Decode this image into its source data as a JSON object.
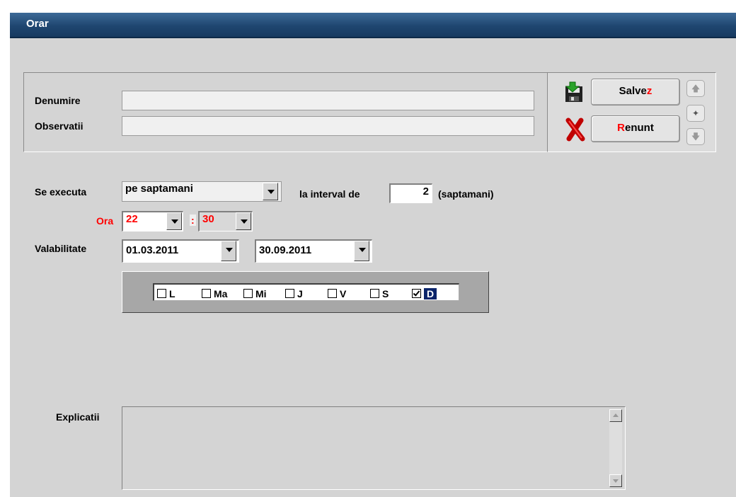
{
  "window": {
    "title": "Orar"
  },
  "form": {
    "denumire_label": "Denumire",
    "denumire_value": "",
    "observatii_label": "Observatii",
    "observatii_value": ""
  },
  "buttons": {
    "save_pre": "Salve",
    "save_hot": "z",
    "cancel_hot": "R",
    "cancel_post": "enunt"
  },
  "schedule": {
    "executa_label": "Se executa",
    "executa_value": "pe saptamani",
    "interval_label": "la interval de",
    "interval_value": "2",
    "interval_unit": "(saptamani)",
    "ora_label": "Ora",
    "ora_hour": "22",
    "ora_sep": ":",
    "ora_minute": "30",
    "validity_label": "Valabilitate",
    "date_from": "01.03.2011",
    "date_to": "30.09.2011"
  },
  "days": [
    {
      "label": "L",
      "checked": false
    },
    {
      "label": "Ma",
      "checked": false
    },
    {
      "label": "Mi",
      "checked": false
    },
    {
      "label": "J",
      "checked": false
    },
    {
      "label": "V",
      "checked": false
    },
    {
      "label": "S",
      "checked": false
    },
    {
      "label": "D",
      "checked": true
    }
  ],
  "explicatii": {
    "label": "Explicatii",
    "value": ""
  },
  "colors": {
    "title_bar": "#1f4670",
    "body": "#d4d4d4",
    "accent_red": "#ff0000",
    "selection": "#0a246a"
  }
}
